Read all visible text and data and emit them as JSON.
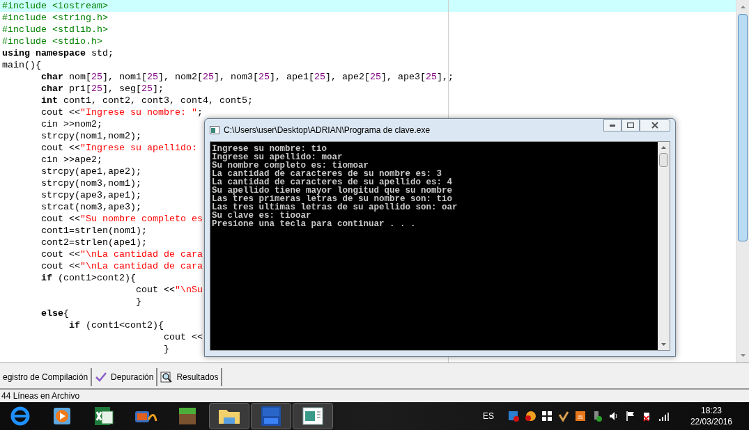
{
  "editor": {
    "lines": [
      {
        "current": true,
        "segments": [
          {
            "kind": "pre",
            "text": "#include <iostream>"
          }
        ]
      },
      {
        "current": false,
        "segments": [
          {
            "kind": "pre",
            "text": "#include <string.h>"
          }
        ]
      },
      {
        "current": false,
        "segments": [
          {
            "kind": "pre",
            "text": "#include <stdlib.h>"
          }
        ]
      },
      {
        "current": false,
        "segments": [
          {
            "kind": "pre",
            "text": "#include <stdio.h>"
          }
        ]
      },
      {
        "current": false,
        "segments": [
          {
            "kind": "kw",
            "text": "using namespace"
          },
          {
            "kind": "p",
            "text": " std;"
          }
        ]
      },
      {
        "current": false,
        "segments": [
          {
            "kind": "p",
            "text": "main(){"
          }
        ]
      },
      {
        "current": false,
        "segments": [
          {
            "kind": "kw",
            "text": "       char"
          },
          {
            "kind": "p",
            "text": " nom["
          },
          {
            "kind": "num",
            "text": "25"
          },
          {
            "kind": "p",
            "text": "], nom1["
          },
          {
            "kind": "num",
            "text": "25"
          },
          {
            "kind": "p",
            "text": "], nom2["
          },
          {
            "kind": "num",
            "text": "25"
          },
          {
            "kind": "p",
            "text": "], nom3["
          },
          {
            "kind": "num",
            "text": "25"
          },
          {
            "kind": "p",
            "text": "], ape1["
          },
          {
            "kind": "num",
            "text": "25"
          },
          {
            "kind": "p",
            "text": "], ape2["
          },
          {
            "kind": "num",
            "text": "25"
          },
          {
            "kind": "p",
            "text": "], ape3["
          },
          {
            "kind": "num",
            "text": "25"
          },
          {
            "kind": "p",
            "text": "],;"
          }
        ]
      },
      {
        "current": false,
        "segments": [
          {
            "kind": "kw",
            "text": "       char"
          },
          {
            "kind": "p",
            "text": " pri["
          },
          {
            "kind": "num",
            "text": "25"
          },
          {
            "kind": "p",
            "text": "], seg["
          },
          {
            "kind": "num",
            "text": "25"
          },
          {
            "kind": "p",
            "text": "];"
          }
        ]
      },
      {
        "current": false,
        "segments": [
          {
            "kind": "kw",
            "text": "       int"
          },
          {
            "kind": "p",
            "text": " cont1, cont2, cont3, cont4, cont5;"
          }
        ]
      },
      {
        "current": false,
        "segments": [
          {
            "kind": "p",
            "text": "       cout <<"
          },
          {
            "kind": "str",
            "text": "\"Ingrese su nombre: \""
          },
          {
            "kind": "p",
            "text": ";"
          }
        ]
      },
      {
        "current": false,
        "segments": [
          {
            "kind": "p",
            "text": "       cin >>nom2;"
          }
        ]
      },
      {
        "current": false,
        "segments": [
          {
            "kind": "p",
            "text": "       strcpy(nom1,nom2);"
          }
        ]
      },
      {
        "current": false,
        "segments": [
          {
            "kind": "p",
            "text": "       cout <<"
          },
          {
            "kind": "str",
            "text": "\"Ingrese su apellido:"
          }
        ]
      },
      {
        "current": false,
        "segments": [
          {
            "kind": "p",
            "text": "       cin >>ape2;"
          }
        ]
      },
      {
        "current": false,
        "segments": [
          {
            "kind": "p",
            "text": "       strcpy(ape1,ape2);"
          }
        ]
      },
      {
        "current": false,
        "segments": [
          {
            "kind": "p",
            "text": "       strcpy(nom3,nom1);"
          }
        ]
      },
      {
        "current": false,
        "segments": [
          {
            "kind": "p",
            "text": "       strcpy(ape3,ape1);"
          }
        ]
      },
      {
        "current": false,
        "segments": [
          {
            "kind": "p",
            "text": "       strcat(nom3,ape3);"
          }
        ]
      },
      {
        "current": false,
        "segments": [
          {
            "kind": "p",
            "text": "       cout <<"
          },
          {
            "kind": "str",
            "text": "\"Su nombre completo es"
          }
        ]
      },
      {
        "current": false,
        "segments": [
          {
            "kind": "p",
            "text": "       cont1=strlen(nom1);"
          }
        ]
      },
      {
        "current": false,
        "segments": [
          {
            "kind": "p",
            "text": "       cont2=strlen(ape1);"
          }
        ]
      },
      {
        "current": false,
        "segments": [
          {
            "kind": "p",
            "text": "       cout <<"
          },
          {
            "kind": "str",
            "text": "\"\\nLa cantidad de cara"
          }
        ]
      },
      {
        "current": false,
        "segments": [
          {
            "kind": "p",
            "text": "       cout <<"
          },
          {
            "kind": "str",
            "text": "\"\\nLa cantidad de cara"
          }
        ]
      },
      {
        "current": false,
        "segments": [
          {
            "kind": "kw",
            "text": "       if"
          },
          {
            "kind": "p",
            "text": " (cont1>cont2){"
          }
        ]
      },
      {
        "current": false,
        "segments": [
          {
            "kind": "p",
            "text": "                        cout <<"
          },
          {
            "kind": "str",
            "text": "\"\\nSu"
          }
        ]
      },
      {
        "current": false,
        "segments": [
          {
            "kind": "p",
            "text": "                        }"
          }
        ]
      },
      {
        "current": false,
        "segments": [
          {
            "kind": "kw",
            "text": "       else"
          },
          {
            "kind": "p",
            "text": "{"
          }
        ]
      },
      {
        "current": false,
        "segments": [
          {
            "kind": "kw",
            "text": "            if"
          },
          {
            "kind": "p",
            "text": " (cont1<cont2){"
          }
        ]
      },
      {
        "current": false,
        "segments": [
          {
            "kind": "p",
            "text": "                             cout <<"
          }
        ]
      },
      {
        "current": false,
        "segments": [
          {
            "kind": "p",
            "text": "                             }"
          }
        ]
      }
    ]
  },
  "console": {
    "title": "C:\\Users\\user\\Desktop\\ADRIAN\\Programa de clave.exe",
    "lines": [
      "Ingrese su nombre: tio",
      "Ingrese su apellido: moar",
      "Su nombre completo es: tiomoar",
      "La cantidad de caracteres de su nombre es: 3",
      "La cantidad de caracteres de su apellido es: 4",
      "Su apellido tiene mayor longitud que su nombre",
      "Las tres primeras letras de su nombre son: tio",
      "Las tres ultimas letras de su apellido son: oar",
      "Su clave es: tiooar",
      "Presione una tecla para continuar . . ."
    ]
  },
  "tabs": [
    {
      "kind": "log",
      "label": "egistro de Compilación"
    },
    {
      "kind": "debug",
      "label": "Depuración"
    },
    {
      "kind": "results",
      "label": "Resultados"
    }
  ],
  "status_bar": "44 Líneas en Archivo",
  "taskbar": {
    "apps": [
      {
        "kind": "browser",
        "running": false
      },
      {
        "kind": "player",
        "running": false
      },
      {
        "kind": "sheet",
        "running": false
      },
      {
        "kind": "movie",
        "running": false
      },
      {
        "kind": "block",
        "running": false
      },
      {
        "kind": "folder",
        "running": true
      },
      {
        "kind": "ide",
        "running": true
      },
      {
        "kind": "console",
        "running": true
      }
    ],
    "language": "ES",
    "time": "18:23",
    "date": "22/03/2016"
  }
}
